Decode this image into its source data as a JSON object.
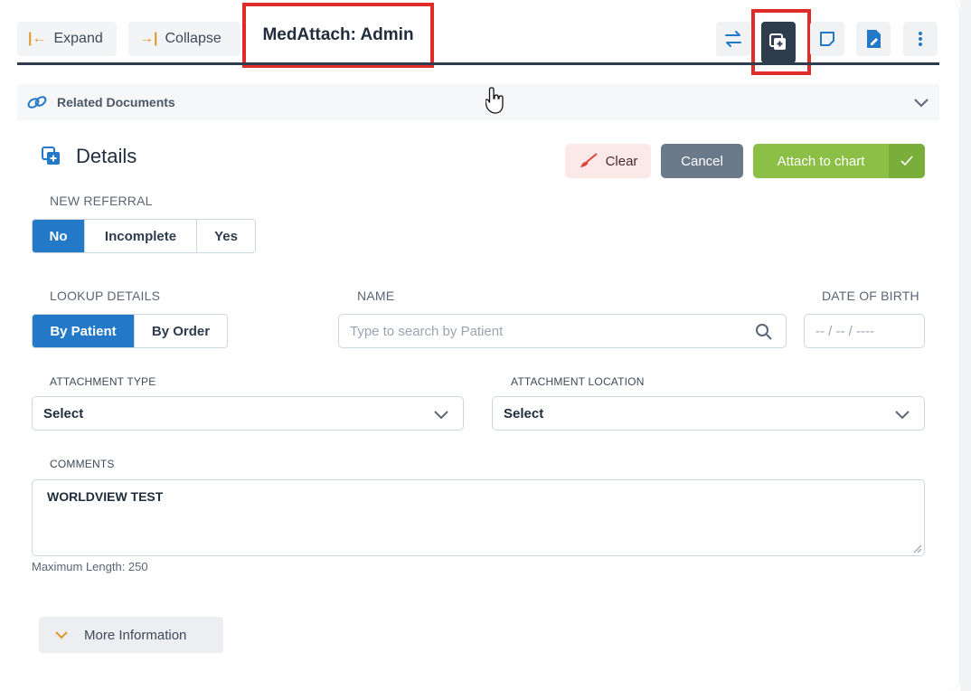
{
  "toolbar": {
    "expand_label": "Expand",
    "collapse_label": "Collapse",
    "title": "MedAttach: Admin",
    "icons": [
      "swap-icon",
      "add-document-icon",
      "note-icon",
      "pdf-edit-icon",
      "more-vert-icon"
    ]
  },
  "related": {
    "label": "Related Documents"
  },
  "details": {
    "title": "Details",
    "clear_label": "Clear",
    "cancel_label": "Cancel",
    "attach_label": "Attach to chart"
  },
  "new_referral": {
    "label": "NEW REFERRAL",
    "options": [
      "No",
      "Incomplete",
      "Yes"
    ],
    "selected": "No"
  },
  "lookup": {
    "label": "LOOKUP DETAILS",
    "options": [
      "By Patient",
      "By Order"
    ],
    "selected": "By Patient"
  },
  "name": {
    "label": "NAME",
    "placeholder": "Type to search by Patient"
  },
  "dob": {
    "label": "DATE OF BIRTH",
    "placeholder": "-- / -- / ----"
  },
  "attachment_type": {
    "label": "ATTACHMENT TYPE",
    "value": "Select"
  },
  "attachment_location": {
    "label": "ATTACHMENT LOCATION",
    "value": "Select"
  },
  "comments": {
    "label": "COMMENTS",
    "value": "WORLDVIEW TEST",
    "max_length_note": "Maximum Length: 250"
  },
  "more_info": {
    "label": "More Information"
  },
  "colors": {
    "primary": "#2379c8",
    "attach_green": "#8bbf45",
    "cancel_gray": "#6b7a8b",
    "highlight_red": "#e02b2b"
  }
}
